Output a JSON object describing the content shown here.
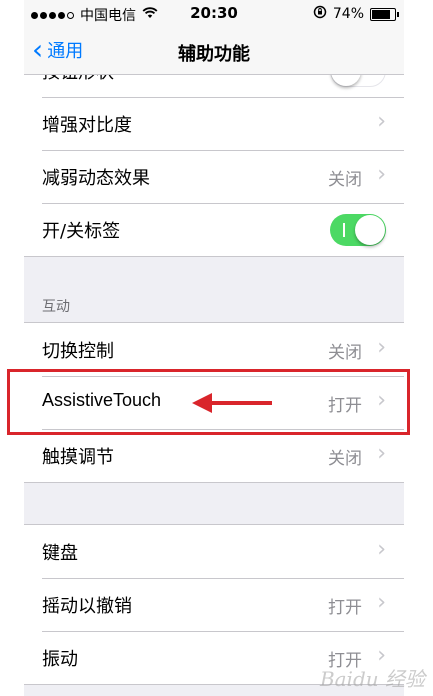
{
  "status_bar": {
    "carrier": "中国电信",
    "time": "20:30",
    "battery": "74%",
    "battery_level": 0.74
  },
  "nav": {
    "back_label": "通用",
    "title": "辅助功能"
  },
  "rows": {
    "partial": {
      "label": "按钮形状"
    },
    "contrast": {
      "label": "增强对比度"
    },
    "reduce_motion": {
      "label": "减弱动态效果",
      "value": "关闭"
    },
    "onoff_labels": {
      "label": "开/关标签",
      "switch_on": true
    }
  },
  "interaction": {
    "header": "互动",
    "switch_control": {
      "label": "切换控制",
      "value": "关闭"
    },
    "assistive_touch": {
      "label": "AssistiveTouch",
      "value": "打开"
    },
    "touch_accommodations": {
      "label": "触摸调节",
      "value": "关闭"
    }
  },
  "more": {
    "keyboard": {
      "label": "键盘"
    },
    "shake_undo": {
      "label": "摇动以撤销",
      "value": "打开"
    },
    "vibration": {
      "label": "振动",
      "value": "打开"
    }
  },
  "annotation": {
    "color": "#d9252b"
  },
  "watermark": "Baidu 经验"
}
